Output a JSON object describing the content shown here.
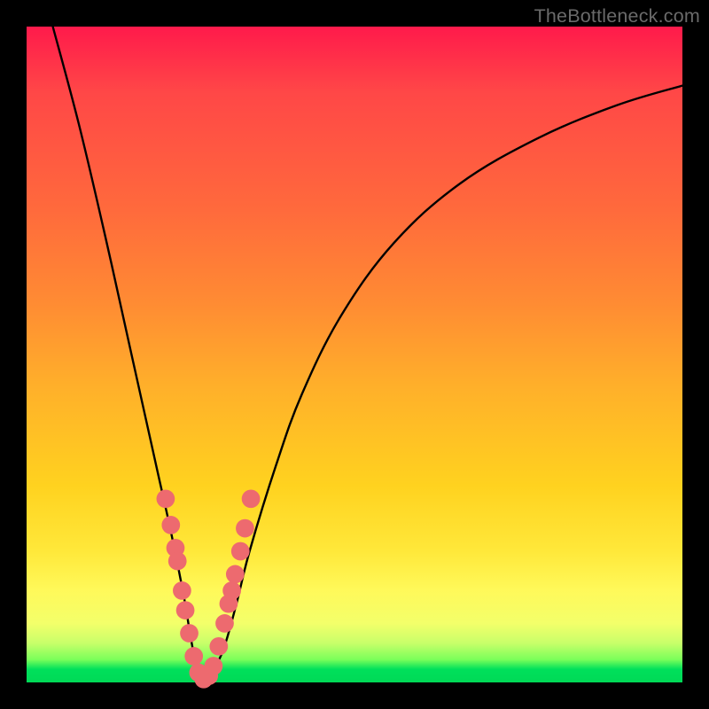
{
  "watermark": "TheBottleneck.com",
  "chart_data": {
    "type": "line",
    "title": "",
    "xlabel": "",
    "ylabel": "",
    "xlim": [
      0,
      100
    ],
    "ylim": [
      0,
      100
    ],
    "grid": false,
    "legend": false,
    "series": [
      {
        "name": "bottleneck-curve",
        "x": [
          4,
          8,
          12,
          16,
          18,
          20,
          22,
          24,
          25,
          26,
          27,
          28,
          30,
          32,
          34,
          38,
          42,
          48,
          56,
          66,
          78,
          90,
          100
        ],
        "values": [
          100,
          85,
          68,
          50,
          41,
          32,
          23,
          13,
          7,
          2,
          0,
          1,
          5,
          12,
          20,
          33,
          44,
          56,
          67,
          76,
          83,
          88,
          91
        ]
      }
    ],
    "dots": {
      "name": "sample-points",
      "color": "#ed6a6f",
      "radius": 1.4,
      "x": [
        21.2,
        22.0,
        22.7,
        23.0,
        23.7,
        24.2,
        24.8,
        25.5,
        26.2,
        27.0,
        27.8,
        28.5,
        29.3,
        30.2,
        30.8,
        31.3,
        31.8,
        32.6,
        33.3,
        34.2
      ],
      "values": [
        28.0,
        24.0,
        20.5,
        18.5,
        14.0,
        11.0,
        7.5,
        4.0,
        1.5,
        0.5,
        1.0,
        2.5,
        5.5,
        9.0,
        12.0,
        14.0,
        16.5,
        20.0,
        23.5,
        28.0
      ]
    }
  }
}
